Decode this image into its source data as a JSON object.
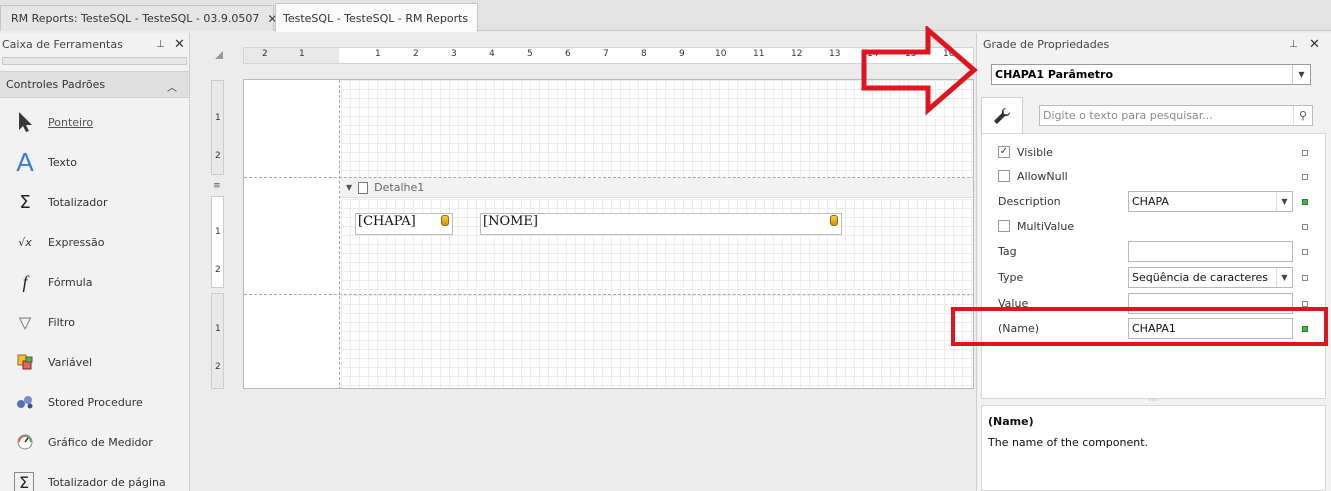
{
  "tabs": [
    {
      "label": "RM Reports: TesteSQL - TesteSQL - 03.9.0507",
      "close": "✕"
    },
    {
      "label": "TesteSQL - TesteSQL - RM Reports"
    }
  ],
  "toolbox": {
    "title": "Caixa de Ferramentas",
    "pin": "⊥",
    "close": "✕",
    "group": "Controles Padrões",
    "items": [
      {
        "label": "Ponteiro",
        "icon": "pointer-icon"
      },
      {
        "label": "Texto",
        "icon": "text-icon",
        "glyph": "A"
      },
      {
        "label": "Totalizador",
        "icon": "sigma-icon",
        "glyph": "Σ"
      },
      {
        "label": "Expressão",
        "icon": "expression-icon",
        "glyph": "√x"
      },
      {
        "label": "Fórmula",
        "icon": "formula-icon",
        "glyph": "f"
      },
      {
        "label": "Filtro",
        "icon": "filter-icon",
        "glyph": "▽"
      },
      {
        "label": "Variável",
        "icon": "variable-icon"
      },
      {
        "label": "Stored Procedure",
        "icon": "stored-procedure-icon"
      },
      {
        "label": "Gráfico de Medidor",
        "icon": "gauge-icon"
      },
      {
        "label": "Totalizador de página",
        "icon": "page-total-icon",
        "glyph": "Σ"
      }
    ]
  },
  "designer": {
    "ruler_h": [
      "2",
      "1",
      "1",
      "2",
      "3",
      "4",
      "5",
      "6",
      "7",
      "8",
      "9",
      "10",
      "11",
      "12",
      "13",
      "14",
      "15",
      "16"
    ],
    "ruler_v1": [
      "1",
      "2"
    ],
    "ruler_v2": [
      "1",
      "2"
    ],
    "ruler_v3": [
      "1",
      "2"
    ],
    "band_label": "Detalhe1",
    "fields": [
      "[CHAPA]",
      "[NOME]"
    ]
  },
  "properties": {
    "title": "Grade de Propriedades",
    "pin": "⊥",
    "close": "✕",
    "selected_object": "CHAPA1  Parâmetro",
    "search_placeholder": "Digite o texto para pesquisar...",
    "rows": {
      "visible": {
        "label": "Visible",
        "checked": "✓"
      },
      "allownull": {
        "label": "AllowNull"
      },
      "description": {
        "label": "Description",
        "value": "CHAPA"
      },
      "multivalue": {
        "label": "MultiValue"
      },
      "tag": {
        "label": "Tag",
        "value": ""
      },
      "type": {
        "label": "Type",
        "value": "Seqüência de caracteres"
      },
      "value": {
        "label": "Value",
        "value": ""
      },
      "name": {
        "label": "(Name)",
        "value": "CHAPA1"
      }
    },
    "description_title": "(Name)",
    "description_text": "The name of the component."
  },
  "colors": {
    "annotation": "#e0141e",
    "accent": "#3a7bd5"
  }
}
